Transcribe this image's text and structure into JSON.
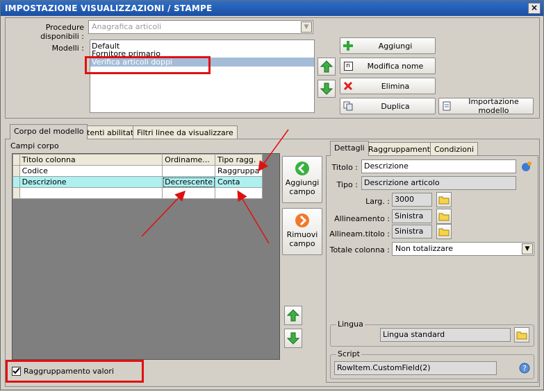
{
  "window": {
    "title": "IMPOSTAZIONE VISUALIZZAZIONI / STAMPE",
    "close_glyph": "×"
  },
  "procedure": {
    "label": "Procedure disponibili :",
    "value": "Anagrafica articoli"
  },
  "modelli": {
    "label": "Modelli :",
    "items": [
      "Default",
      "Fornitore primario",
      "Verifica articoli doppi"
    ],
    "selected_index": 2
  },
  "buttons": {
    "aggiungi": "Aggiungi",
    "modifica_nome": "Modifica nome",
    "elimina": "Elimina",
    "duplica": "Duplica",
    "importazione": "Importazione modello"
  },
  "tabs_main": [
    "Corpo del modello",
    "Utenti abilitati",
    "Filtri linee da visualizzare"
  ],
  "campi_corpo": {
    "title": "Campi corpo",
    "columns": [
      "Titolo colonna",
      "Ordiname...",
      "Tipo ragg."
    ],
    "rows": [
      [
        "Codice",
        "",
        "Raggruppa"
      ],
      [
        "Descrizione",
        "Decrescente",
        "Conta"
      ],
      [
        "",
        "",
        ""
      ]
    ],
    "selected_row": 1
  },
  "side_buttons": {
    "aggiungi_campo": [
      "Aggiungi",
      "campo"
    ],
    "rimuovi_campo": [
      "Rimuovi",
      "campo"
    ]
  },
  "tabs_detail": [
    "Dettagli",
    "Raggruppamento",
    "Condizioni"
  ],
  "dettagli": {
    "titolo_label": "Titolo :",
    "titolo_value": "Descrizione",
    "tipo_label": "Tipo :",
    "tipo_value": "Descrizione articolo",
    "larg_label": "Larg. :",
    "larg_value": "3000",
    "allineamento_label": "Allineamento :",
    "allineamento_value": "Sinistra",
    "allineam_titolo_label": "Allineam.titolo :",
    "allineam_titolo_value": "Sinistra",
    "totale_label": "Totale colonna :",
    "totale_value": "Non totalizzare"
  },
  "lingua": {
    "title": "Lingua",
    "value": "Lingua standard"
  },
  "script": {
    "title": "Script",
    "value": "RowItem.CustomField(2)"
  },
  "raggruppamento": {
    "label": "Raggruppamento valori",
    "checked": true
  },
  "colors": {
    "accent_title": "#1b4fa3",
    "highlight": "#e01010",
    "selected_row": "#aef0f0"
  }
}
